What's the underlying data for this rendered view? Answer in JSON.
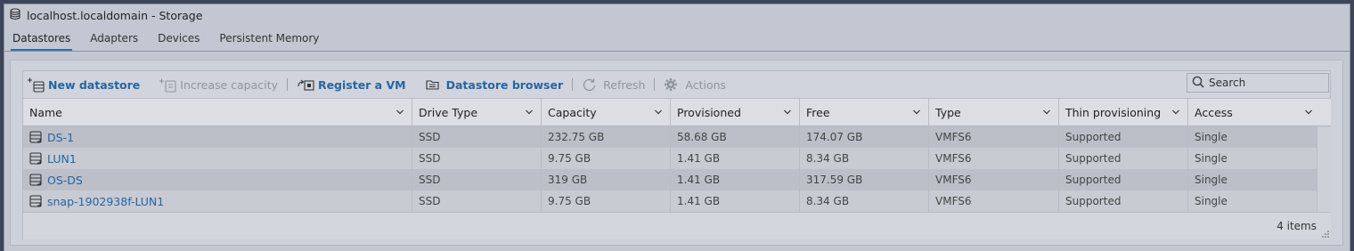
{
  "window": {
    "title": "localhost.localdomain - Storage",
    "icon": "storage-icon"
  },
  "tabs": [
    {
      "label": "Datastores",
      "active": true
    },
    {
      "label": "Adapters",
      "active": false
    },
    {
      "label": "Devices",
      "active": false
    },
    {
      "label": "Persistent Memory",
      "active": false
    }
  ],
  "toolbar": {
    "new_datastore": "New datastore",
    "increase_capacity": "Increase capacity",
    "register_vm": "Register a VM",
    "datastore_browser": "Datastore browser",
    "refresh": "Refresh",
    "actions": "Actions"
  },
  "search": {
    "placeholder": "Search"
  },
  "table": {
    "columns": [
      "Name",
      "Drive Type",
      "Capacity",
      "Provisioned",
      "Free",
      "Type",
      "Thin provisioning",
      "Access"
    ],
    "rows": [
      {
        "name": "DS-1",
        "drive_type": "SSD",
        "capacity": "232.75 GB",
        "provisioned": "58.68 GB",
        "free": "174.07 GB",
        "type": "VMFS6",
        "thin": "Supported",
        "access": "Single"
      },
      {
        "name": "LUN1",
        "drive_type": "SSD",
        "capacity": "9.75 GB",
        "provisioned": "1.41 GB",
        "free": "8.34 GB",
        "type": "VMFS6",
        "thin": "Supported",
        "access": "Single"
      },
      {
        "name": "OS-DS",
        "drive_type": "SSD",
        "capacity": "319 GB",
        "provisioned": "1.41 GB",
        "free": "317.59 GB",
        "type": "VMFS6",
        "thin": "Supported",
        "access": "Single"
      },
      {
        "name": "snap-1902938f-LUN1",
        "drive_type": "SSD",
        "capacity": "9.75 GB",
        "provisioned": "1.41 GB",
        "free": "8.34 GB",
        "type": "VMFS6",
        "thin": "Supported",
        "access": "Single"
      }
    ],
    "footer_count": "4 items"
  },
  "colors": {
    "link": "#2466a3",
    "disabled": "#8e949e",
    "active_tab": "#2e6fa8"
  }
}
